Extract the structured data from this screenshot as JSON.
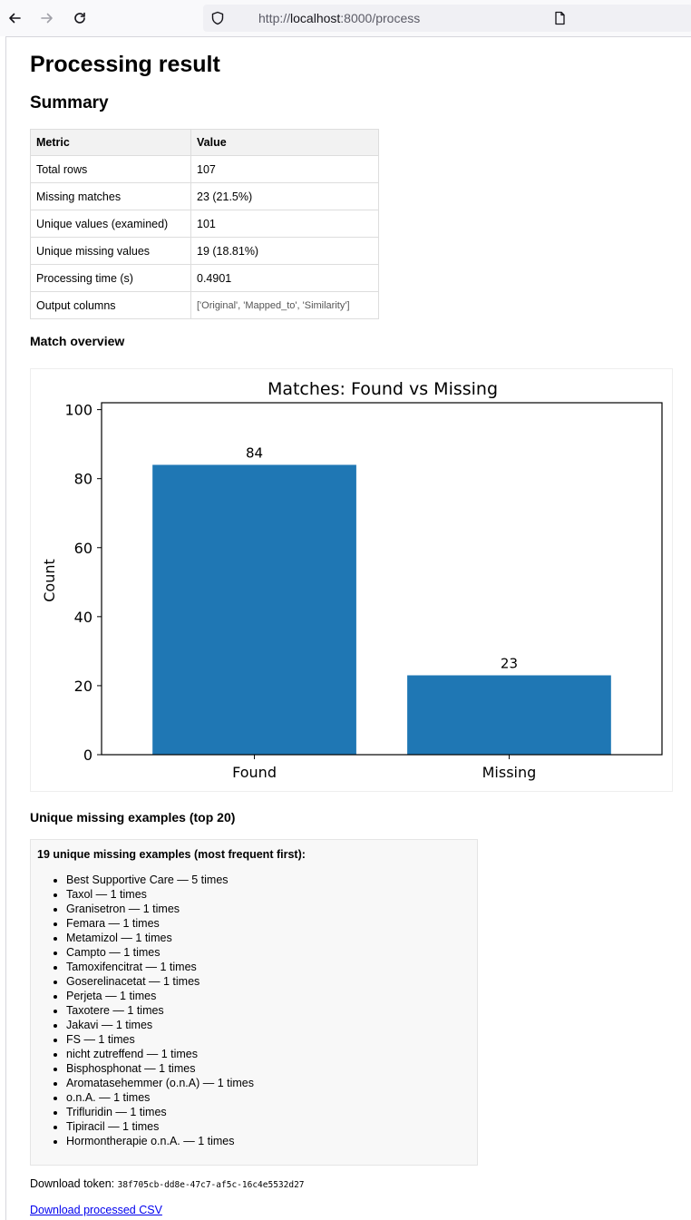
{
  "browser": {
    "url_prefix": "http://",
    "url_host": "localhost",
    "url_rest": ":8000/process"
  },
  "page": {
    "title": "Processing result",
    "summary_heading": "Summary"
  },
  "summary_table": {
    "headers": [
      "Metric",
      "Value"
    ],
    "rows": [
      [
        "Total rows",
        "107"
      ],
      [
        "Missing matches",
        "23 (21.5%)"
      ],
      [
        "Unique values (examined)",
        "101"
      ],
      [
        "Unique missing values",
        "19 (18.81%)"
      ],
      [
        "Processing time (s)",
        "0.4901"
      ],
      [
        "Output columns",
        "['Original', 'Mapped_to', 'Similarity']"
      ]
    ]
  },
  "match_overview_heading": "Match overview",
  "chart_data": {
    "type": "bar",
    "title": "Matches: Found vs Missing",
    "categories": [
      "Found",
      "Missing"
    ],
    "values": [
      84,
      23
    ],
    "data_labels": [
      "84",
      "23"
    ],
    "xlabel": "",
    "ylabel": "Count",
    "ylim": [
      0,
      102
    ],
    "yticks": [
      0,
      20,
      40,
      60,
      80,
      100
    ],
    "grid": false,
    "bar_color": "#1f77b4"
  },
  "missing_section": {
    "heading": "Unique missing examples (top 20)",
    "box_title": "19 unique missing examples (most frequent first):",
    "items": [
      "Best Supportive Care — 5 times",
      "Taxol — 1 times",
      "Granisetron — 1 times",
      "Femara — 1 times",
      "Metamizol — 1 times",
      "Campto — 1 times",
      "Tamoxifencitrat — 1 times",
      "Goserelinacetat — 1 times",
      "Perjeta — 1 times",
      "Taxotere — 1 times",
      "Jakavi — 1 times",
      "FS — 1 times",
      "nicht zutreffend — 1 times",
      "Bisphosphonat — 1 times",
      "Aromatasehemmer (o.n.A) — 1 times",
      "o.n.A. — 1 times",
      "Trifluridin — 1 times",
      "Tipiracil — 1 times",
      "Hormontherapie o.n.A. — 1 times"
    ]
  },
  "download": {
    "token_label": "Download token:",
    "token_value": "38f705cb-dd8e-47c7-af5c-16c4e5532d27",
    "link_label": "Download processed CSV"
  }
}
